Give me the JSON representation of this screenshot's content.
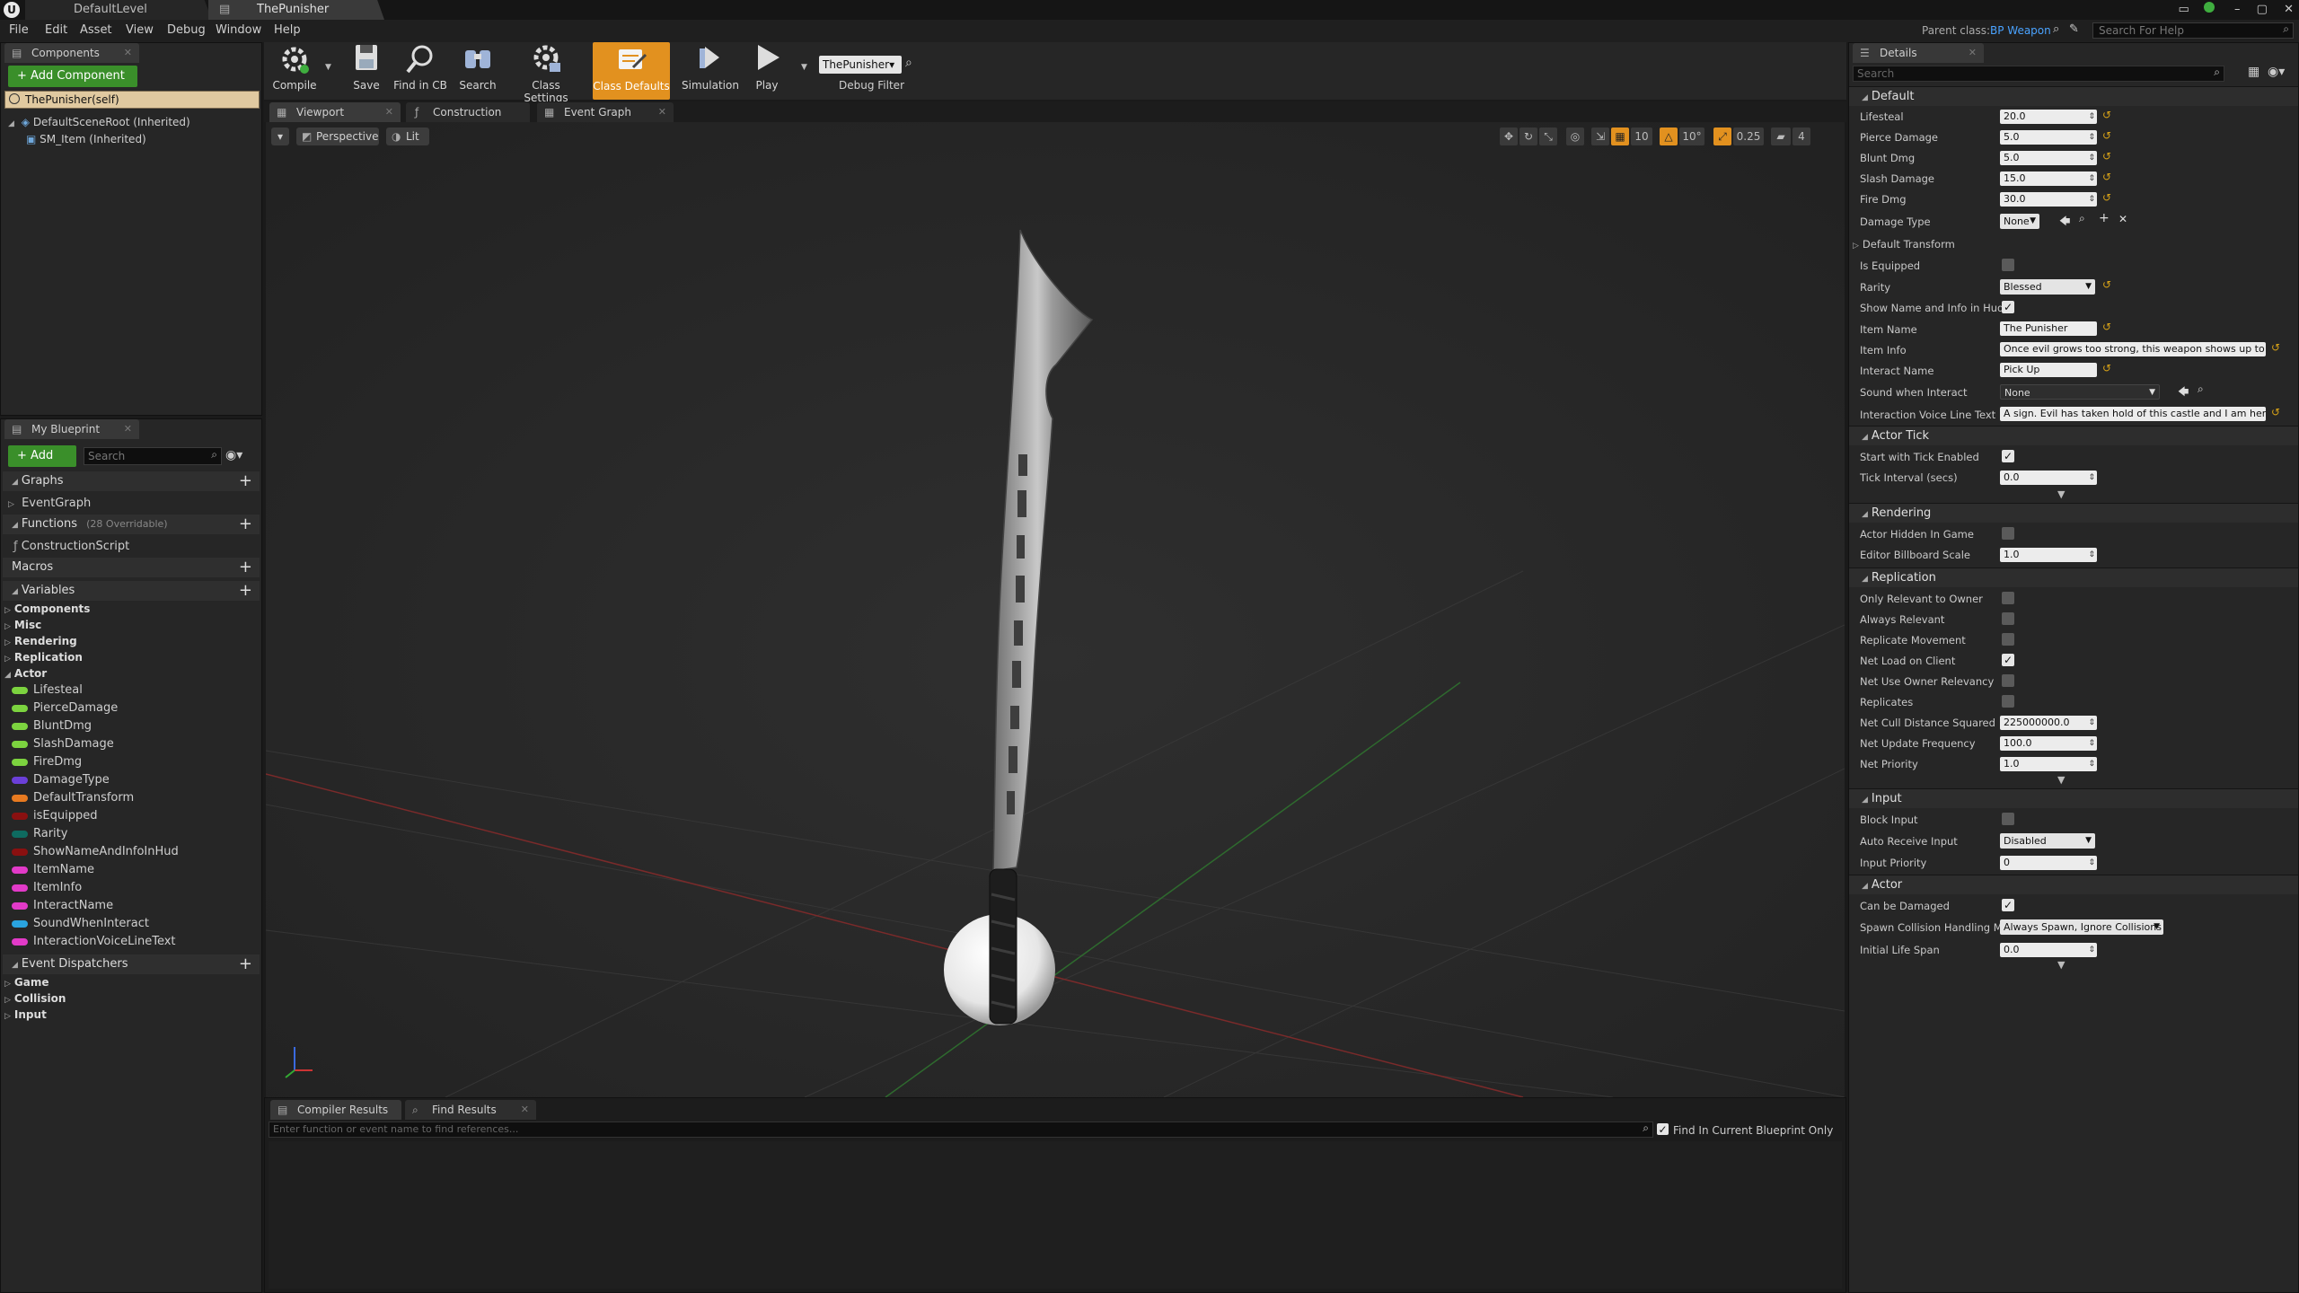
{
  "window": {
    "tabs": [
      {
        "label": "DefaultLevel"
      },
      {
        "label": "ThePunisher"
      }
    ],
    "parent_class_label": "Parent class:",
    "parent_class_value": "BP Weapon",
    "help_search_placeholder": "Search For Help"
  },
  "menu": [
    "File",
    "Edit",
    "Asset",
    "View",
    "Debug",
    "Window",
    "Help"
  ],
  "components_panel": {
    "tab": "Components",
    "add_button": "+ Add Component ▾",
    "self_item": "ThePunisher(self)",
    "tree": [
      {
        "label": "DefaultSceneRoot (Inherited)"
      },
      {
        "label": "SM_Item (Inherited)"
      }
    ]
  },
  "my_blueprint": {
    "tab": "My Blueprint",
    "add_new": "+ Add New ▾",
    "search_placeholder": "Search",
    "sections": {
      "graphs": "Graphs",
      "event_graph": "EventGraph",
      "functions": "Functions",
      "functions_note": "(28 Overridable)",
      "construction_script": "ConstructionScript",
      "macros": "Macros",
      "variables": "Variables",
      "event_dispatchers": "Event Dispatchers"
    },
    "variable_categories": [
      "Components",
      "Misc",
      "Rendering",
      "Replication",
      "Actor"
    ],
    "variables": [
      {
        "name": "Lifesteal",
        "color": "#7cd33f"
      },
      {
        "name": "PierceDamage",
        "color": "#7cd33f"
      },
      {
        "name": "BluntDmg",
        "color": "#7cd33f"
      },
      {
        "name": "SlashDamage",
        "color": "#7cd33f"
      },
      {
        "name": "FireDmg",
        "color": "#7cd33f"
      },
      {
        "name": "DamageType",
        "color": "#6b3fd8"
      },
      {
        "name": "DefaultTransform",
        "color": "#e87a20"
      },
      {
        "name": "isEquipped",
        "color": "#8a1010"
      },
      {
        "name": "Rarity",
        "color": "#0e6b60"
      },
      {
        "name": "ShowNameAndInfoInHud",
        "color": "#8a1010"
      },
      {
        "name": "ItemName",
        "color": "#e23ac8"
      },
      {
        "name": "ItemInfo",
        "color": "#e23ac8"
      },
      {
        "name": "InteractName",
        "color": "#e23ac8"
      },
      {
        "name": "SoundWhenInteract",
        "color": "#2aa4e0"
      },
      {
        "name": "InteractionVoiceLineText",
        "color": "#e23ac8"
      }
    ],
    "dispatcher_categories": [
      "Game",
      "Collision",
      "Input"
    ]
  },
  "toolbar": {
    "compile": "Compile",
    "save": "Save",
    "find_in_cb": "Find in CB",
    "search": "Search",
    "class_settings": "Class Settings",
    "class_defaults": "Class Defaults",
    "simulation": "Simulation",
    "play": "Play",
    "debug_object": "ThePunisher▾",
    "debug_filter": "Debug Filter"
  },
  "editor_tabs": [
    "Viewport",
    "Construction Script",
    "Event Graph"
  ],
  "viewport": {
    "perspective": "Perspective",
    "lit": "Lit",
    "grid_snap": "10",
    "rot_snap": "10°",
    "scale_snap": "0.25",
    "camera_speed": "4"
  },
  "bottom_panel": {
    "tabs": [
      "Compiler Results",
      "Find Results"
    ],
    "find_placeholder": "Enter function or event name to find references...",
    "find_current_only": "Find In Current Blueprint Only"
  },
  "details": {
    "tab": "Details",
    "search_placeholder": "Search",
    "sections": {
      "default": "Default",
      "actor_tick": "Actor Tick",
      "rendering": "Rendering",
      "replication": "Replication",
      "input": "Input",
      "actor": "Actor"
    },
    "default_props": {
      "lifesteal_label": "Lifesteal",
      "lifesteal": "20.0",
      "pierce_label": "Pierce Damage",
      "pierce": "5.0",
      "blunt_label": "Blunt Dmg",
      "blunt": "5.0",
      "slash_label": "Slash Damage",
      "slash": "15.0",
      "fire_label": "Fire Dmg",
      "fire": "30.0",
      "damage_type_label": "Damage Type",
      "damage_type": "None",
      "default_transform_label": "Default Transform",
      "is_equipped_label": "Is Equipped",
      "rarity_label": "Rarity",
      "rarity": "Blessed",
      "show_name_label": "Show Name and Info in Hud",
      "item_name_label": "Item Name",
      "item_name": "The Punisher",
      "item_info_label": "Item Info",
      "item_info": "Once evil grows too strong, this weapon shows up to rebu",
      "interact_name_label": "Interact Name",
      "interact_name": "Pick Up",
      "sound_label": "Sound when Interact",
      "sound": "None",
      "voice_line_label": "Interaction Voice Line Text",
      "voice_line": "A sign. Evil has taken hold of this castle and I am here to"
    },
    "tick_props": {
      "start_tick_label": "Start with Tick Enabled",
      "tick_interval_label": "Tick Interval (secs)",
      "tick_interval": "0.0"
    },
    "render_props": {
      "hidden_label": "Actor Hidden In Game",
      "billboard_label": "Editor Billboard Scale",
      "billboard": "1.0"
    },
    "replication_props": {
      "only_relevant_label": "Only Relevant to Owner",
      "always_relevant_label": "Always Relevant",
      "replicate_movement_label": "Replicate Movement",
      "net_load_label": "Net Load on Client",
      "net_owner_label": "Net Use Owner Relevancy",
      "replicates_label": "Replicates",
      "cull_label": "Net Cull Distance Squared",
      "cull": "225000000.0",
      "update_freq_label": "Net Update Frequency",
      "update_freq": "100.0",
      "priority_label": "Net Priority",
      "priority": "1.0"
    },
    "input_props": {
      "block_label": "Block Input",
      "auto_receive_label": "Auto Receive Input",
      "auto_receive": "Disabled",
      "input_priority_label": "Input Priority",
      "input_priority": "0"
    },
    "actor_props": {
      "can_damage_label": "Can be Damaged",
      "spawn_label": "Spawn Collision Handling Met",
      "spawn": "Always Spawn, Ignore Collisions",
      "life_span_label": "Initial Life Span",
      "life_span": "0.0"
    }
  },
  "colors": {
    "accent_orange": "#e2911f",
    "add_green": "#3a8f2a",
    "parent_class_blue": "#4aa3ff"
  }
}
